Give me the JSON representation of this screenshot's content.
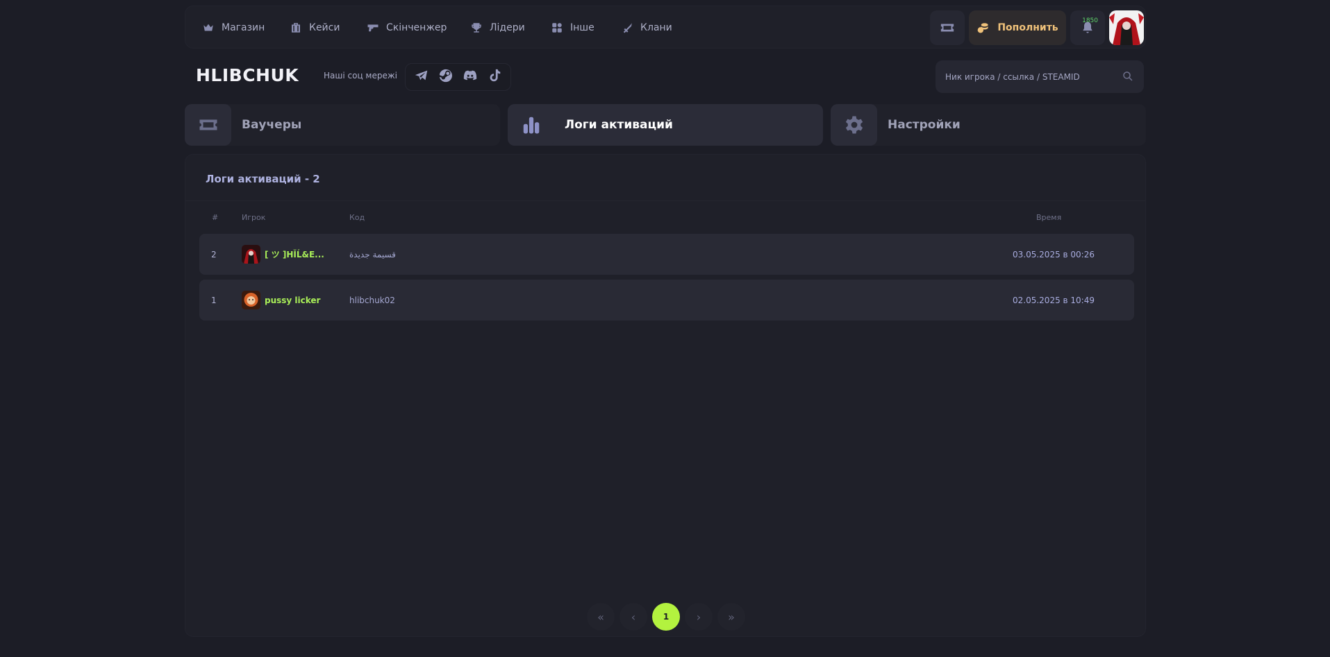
{
  "nav": {
    "items": [
      {
        "label": "Магазин",
        "icon": "crown-icon"
      },
      {
        "label": "Кейси",
        "icon": "case-icon"
      },
      {
        "label": "Скінченжер",
        "icon": "gun-icon"
      },
      {
        "label": "Лідери",
        "icon": "trophy-icon"
      },
      {
        "label": "Інше",
        "icon": "apps-icon"
      },
      {
        "label": "Клани",
        "icon": "swords-icon"
      }
    ],
    "topup_label": "Пополнить",
    "notification_count": "1850"
  },
  "brand": {
    "logo": "HLIBCHUK",
    "social_label": "Наші соц мережі",
    "socials": [
      "telegram-icon",
      "steam-icon",
      "discord-icon",
      "tiktok-icon"
    ]
  },
  "search": {
    "placeholder": "Ник игрока / ссылка / STEAMID"
  },
  "tabs": [
    {
      "label": "Ваучеры",
      "icon": "ticket-icon",
      "active": false
    },
    {
      "label": "Логи активаций",
      "icon": "bar-chart-icon",
      "active": true
    },
    {
      "label": "Настройки",
      "icon": "gear-icon",
      "active": false
    }
  ],
  "content": {
    "title": "Логи активаций - 2",
    "columns": [
      "#",
      "Игрок",
      "Код",
      "Время"
    ],
    "rows": [
      {
        "num": "2",
        "player": "[ ツ ]HĬĹ&E...",
        "code": "قسيمة جديدة",
        "time": "03.05.2025 в 00:26"
      },
      {
        "num": "1",
        "player": "pussy licker",
        "code": "hlibchuk02",
        "time": "02.05.2025 в 10:49"
      }
    ]
  },
  "pagination": {
    "first": "«",
    "prev": "‹",
    "current": "1",
    "next": "›",
    "last": "»"
  },
  "colors": {
    "background": "#1c1d26",
    "accent": "#b3f23f",
    "player_name": "#a9ee58",
    "topup_text": "#f0c27a"
  }
}
